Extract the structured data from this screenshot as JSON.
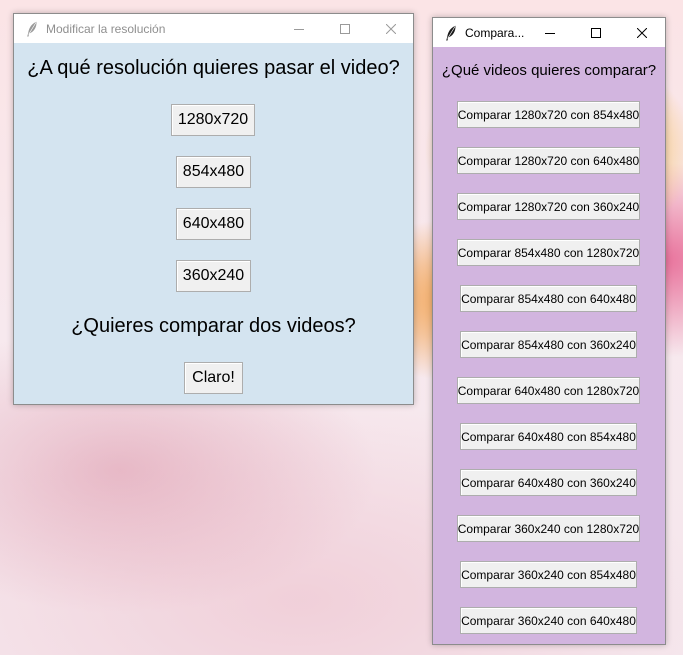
{
  "window_resolution": {
    "title": "Modificar la resolución",
    "question": "¿A qué resolución quieres pasar el video?",
    "resolution_buttons": [
      "1280x720",
      "854x480",
      "640x480",
      "360x240"
    ],
    "compare_question": "¿Quieres comparar dos videos?",
    "compare_button": "Claro!",
    "background_color": "#d4e4f0"
  },
  "window_compare": {
    "title": "Compara...",
    "question": "¿Qué videos quieres comparar?",
    "buttons": [
      "Comparar 1280x720 con 854x480",
      "Comparar 1280x720 con 640x480",
      "Comparar 1280x720 con 360x240",
      "Comparar 854x480 con 1280x720",
      "Comparar 854x480 con 640x480",
      "Comparar 854x480 con 360x240",
      "Comparar 640x480 con 1280x720",
      "Comparar 640x480 con 854x480",
      "Comparar 640x480 con 360x240",
      "Comparar 360x240 con 1280x720",
      "Comparar 360x240 con 854x480",
      "Comparar 360x240 con 640x480"
    ],
    "background_color": "#d2b5df"
  },
  "icons": {
    "app": "feather-icon",
    "minimize": "minimize-icon",
    "maximize": "maximize-icon",
    "close": "close-icon"
  }
}
